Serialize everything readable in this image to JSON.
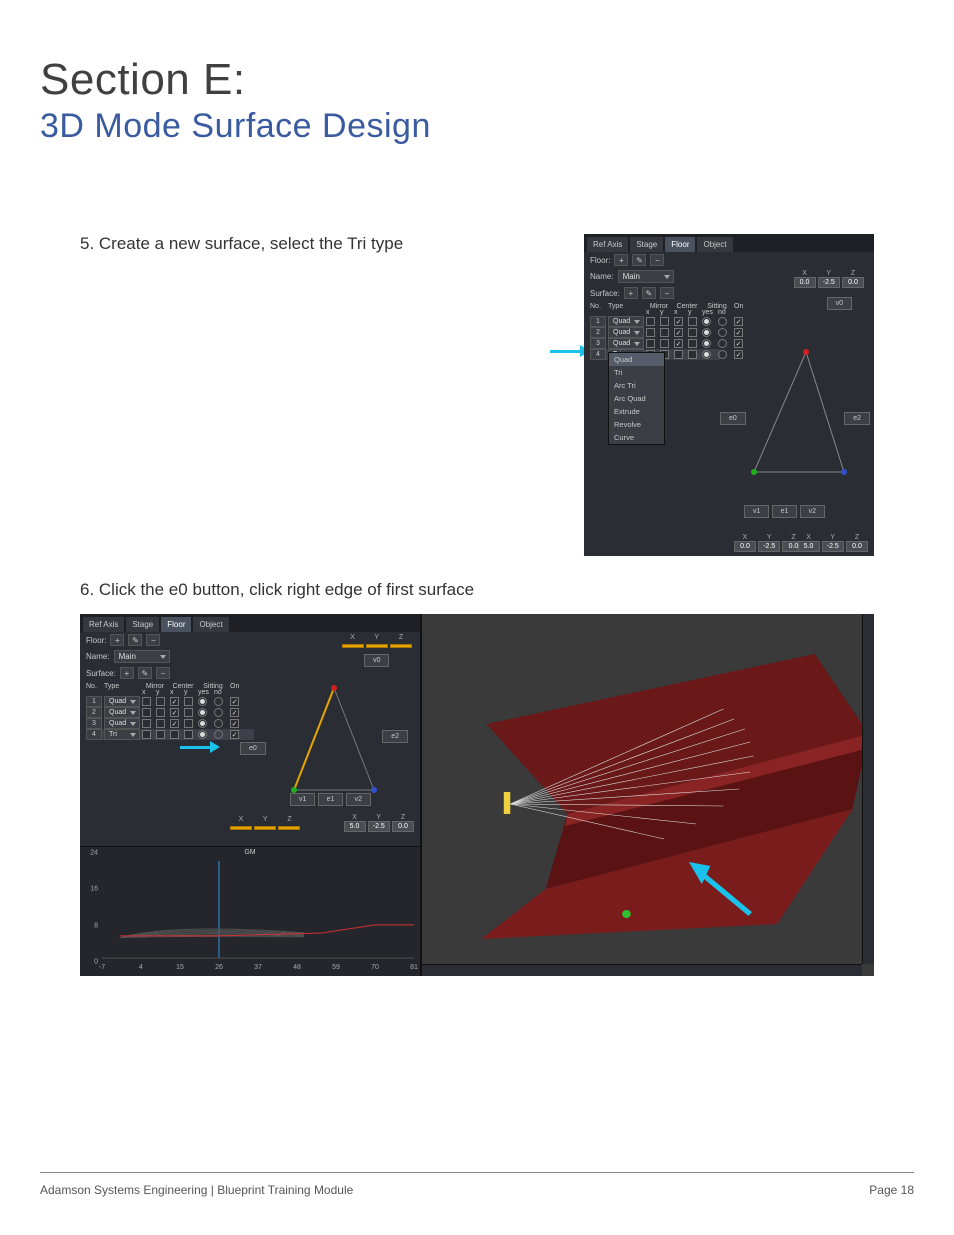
{
  "header": {
    "section": "Section E:",
    "subtitle": "3D Mode Surface Design"
  },
  "steps": {
    "s5": "5. Create a new surface, select the Tri type",
    "s6": "6. Click the e0 button, click right edge of first surface"
  },
  "tabs": {
    "t1": "Ref Axis",
    "t2": "Stage",
    "t3": "Floor",
    "t4": "Object"
  },
  "labels": {
    "floor": "Floor:",
    "name": "Name:",
    "surface": "Surface:",
    "no": "No.",
    "type": "Type",
    "mirror": "Mirror",
    "center": "Center",
    "sitting": "Sitting",
    "on": "On",
    "x": "x",
    "y": "y",
    "yes": "yes",
    "no2": "no",
    "X": "X",
    "Y": "Y",
    "Z": "Z"
  },
  "name_value": "Main",
  "icons": {
    "plus": "+",
    "pencil": "✎",
    "minus": "−"
  },
  "fig1_rows": [
    {
      "n": "1",
      "type": "Quad"
    },
    {
      "n": "2",
      "type": "Quad"
    },
    {
      "n": "3",
      "type": "Quad"
    },
    {
      "n": "4",
      "type": "Tri"
    }
  ],
  "type_options": [
    "Quad",
    "Tri",
    "Arc Tri",
    "Arc Quad",
    "Extrude",
    "Revolve",
    "Curve"
  ],
  "buttons": {
    "v0": "v0",
    "v1": "v1",
    "v2": "v2",
    "e0": "e0",
    "e1": "e1",
    "e2": "e2"
  },
  "tr_coords": {
    "x": "0.0",
    "y": "-2.5",
    "z": "0.0"
  },
  "bl_coords": {
    "x": "0.0",
    "y": "-2.5",
    "z": "0.0"
  },
  "br_coords": {
    "x": "5.0",
    "y": "-2.5",
    "z": "0.0"
  },
  "fig2_tr_coords": {
    "x": "",
    "y": "",
    "z": ""
  },
  "fig2_bl_coords": {
    "x": "",
    "y": "",
    "z": ""
  },
  "fig2_br_coords": {
    "x": "5.0",
    "y": "-2.5",
    "z": "0.0"
  },
  "chart_data": {
    "type": "line",
    "title": "GM",
    "x_ticks": [
      "-7",
      "4",
      "15",
      "26",
      "37",
      "48",
      "59",
      "70",
      "81"
    ],
    "y_ticks": [
      "24",
      "16",
      "8",
      "0"
    ],
    "xlim": [
      -7,
      81
    ],
    "ylim": [
      0,
      24
    ],
    "marker_x": 26,
    "series": [
      {
        "name": "red",
        "values": [
          [
            -2,
            5.5
          ],
          [
            26,
            5.5
          ],
          [
            55,
            6.2
          ],
          [
            70,
            8.2
          ],
          [
            81,
            8.2
          ]
        ]
      }
    ]
  },
  "footer": {
    "left_a": "Adamson Systems Engineering",
    "sep": "  |  ",
    "left_b": "Blueprint Training Module",
    "right": "Page 18"
  }
}
